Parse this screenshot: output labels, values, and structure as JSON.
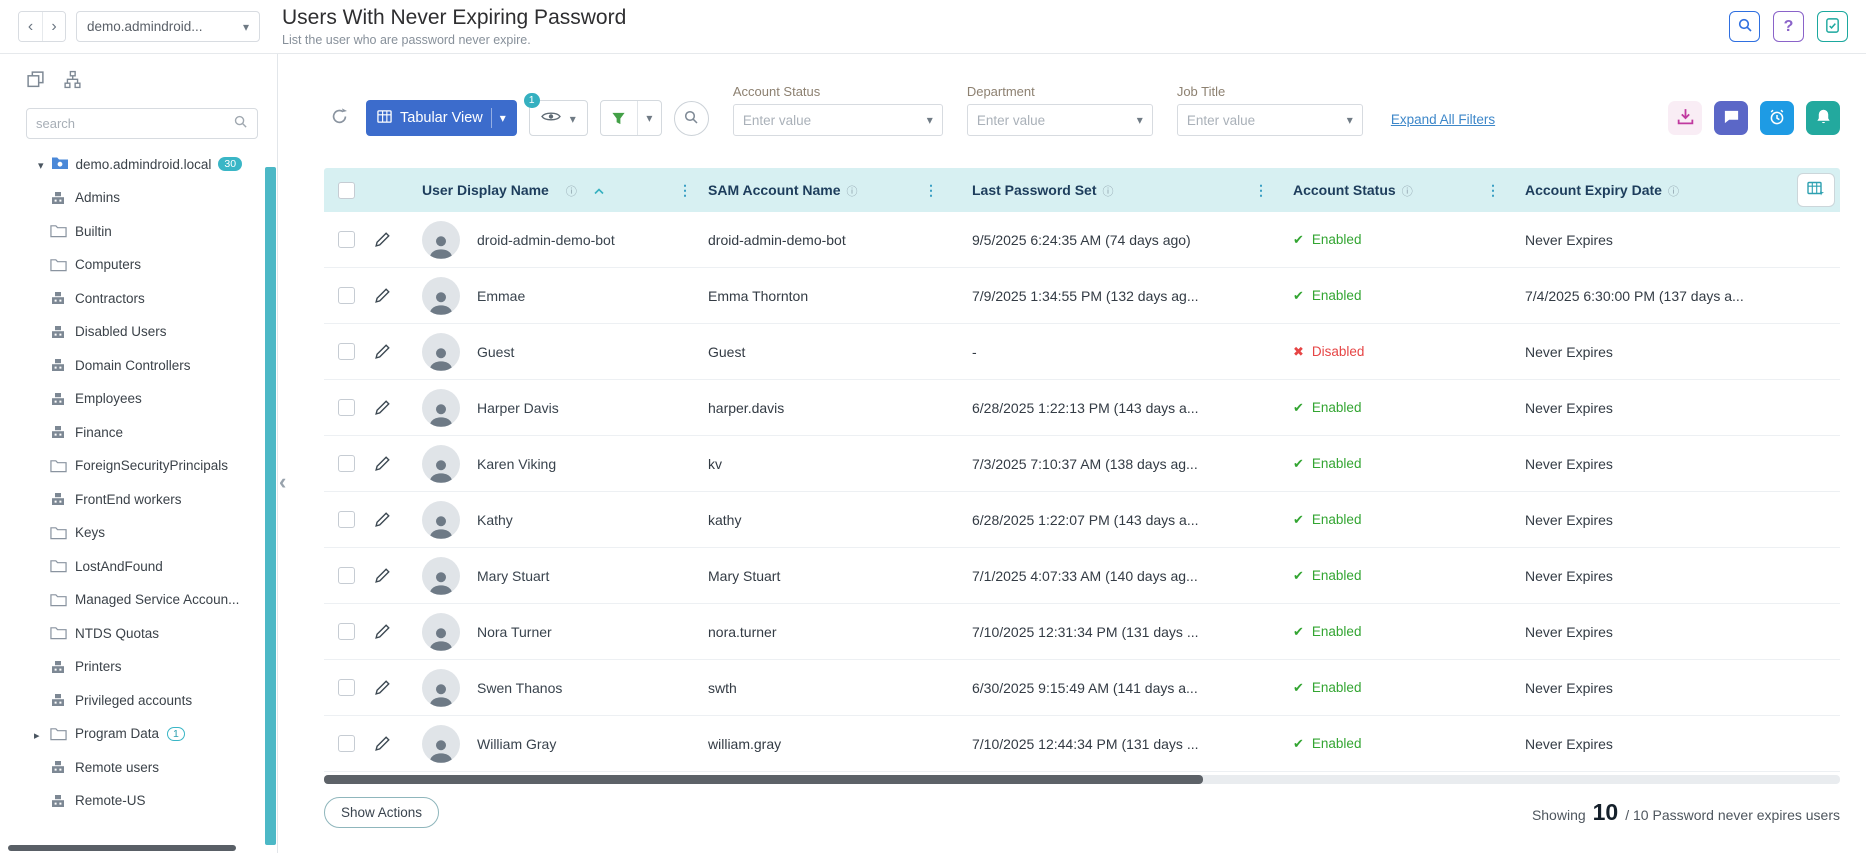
{
  "topbar": {
    "domain_selector": "demo.admindroid...",
    "title": "Users With Never Expiring Password",
    "subtitle": "List the user who are password never expire."
  },
  "sidebar": {
    "search_placeholder": "search",
    "tree_root": {
      "label": "demo.admindroid.local",
      "badge": "30"
    },
    "tree_items": [
      {
        "label": "Admins",
        "icon": "group"
      },
      {
        "label": "Builtin",
        "icon": "folder"
      },
      {
        "label": "Computers",
        "icon": "folder"
      },
      {
        "label": "Contractors",
        "icon": "group"
      },
      {
        "label": "Disabled Users",
        "icon": "group"
      },
      {
        "label": "Domain Controllers",
        "icon": "group"
      },
      {
        "label": "Employees",
        "icon": "group"
      },
      {
        "label": "Finance",
        "icon": "group"
      },
      {
        "label": "ForeignSecurityPrincipals",
        "icon": "folder"
      },
      {
        "label": "FrontEnd workers",
        "icon": "group"
      },
      {
        "label": "Keys",
        "icon": "folder"
      },
      {
        "label": "LostAndFound",
        "icon": "folder"
      },
      {
        "label": "Managed Service Accoun...",
        "icon": "folder"
      },
      {
        "label": "NTDS Quotas",
        "icon": "folder"
      },
      {
        "label": "Printers",
        "icon": "group"
      },
      {
        "label": "Privileged accounts",
        "icon": "group"
      },
      {
        "label": "Program Data",
        "icon": "folder",
        "badge": "1",
        "expandable": true
      },
      {
        "label": "Remote users",
        "icon": "group"
      },
      {
        "label": "Remote-US",
        "icon": "group"
      }
    ]
  },
  "toolbar": {
    "view_label": "Tabular View",
    "views_badge": "1",
    "filters": [
      {
        "label": "Account Status",
        "placeholder": "Enter value"
      },
      {
        "label": "Department",
        "placeholder": "Enter value"
      },
      {
        "label": "Job Title",
        "placeholder": "Enter value"
      }
    ],
    "expand_filters_label": "Expand All Filters"
  },
  "table": {
    "columns": [
      "User Display Name",
      "SAM Account Name",
      "Last Password Set",
      "Account Status",
      "Account Expiry Date"
    ],
    "rows": [
      {
        "display_name": "droid-admin-demo-bot",
        "sam": "droid-admin-demo-bot",
        "last_set": "9/5/2025 6:24:35 AM (74 days ago)",
        "status": "Enabled",
        "expiry": "Never Expires"
      },
      {
        "display_name": "Emmae",
        "sam": "Emma Thornton",
        "last_set": "7/9/2025 1:34:55 PM (132 days ag...",
        "status": "Enabled",
        "expiry": "7/4/2025 6:30:00 PM (137 days a..."
      },
      {
        "display_name": "Guest",
        "sam": "Guest",
        "last_set": "-",
        "status": "Disabled",
        "expiry": "Never Expires"
      },
      {
        "display_name": "Harper Davis",
        "sam": "harper.davis",
        "last_set": "6/28/2025 1:22:13 PM (143 days a...",
        "status": "Enabled",
        "expiry": "Never Expires"
      },
      {
        "display_name": "Karen Viking",
        "sam": "kv",
        "last_set": "7/3/2025 7:10:37 AM (138 days ag...",
        "status": "Enabled",
        "expiry": "Never Expires"
      },
      {
        "display_name": "Kathy",
        "sam": "kathy",
        "last_set": "6/28/2025 1:22:07 PM (143 days a...",
        "status": "Enabled",
        "expiry": "Never Expires"
      },
      {
        "display_name": "Mary Stuart",
        "sam": "Mary Stuart",
        "last_set": "7/1/2025 4:07:33 AM (140 days ag...",
        "status": "Enabled",
        "expiry": "Never Expires"
      },
      {
        "display_name": "Nora Turner",
        "sam": "nora.turner",
        "last_set": "7/10/2025 12:31:34 PM (131 days ...",
        "status": "Enabled",
        "expiry": "Never Expires"
      },
      {
        "display_name": "Swen Thanos",
        "sam": "swth",
        "last_set": "6/30/2025 9:15:49 AM (141 days a...",
        "status": "Enabled",
        "expiry": "Never Expires"
      },
      {
        "display_name": "William Gray",
        "sam": "william.gray",
        "last_set": "7/10/2025 12:44:34 PM (131 days ...",
        "status": "Enabled",
        "expiry": "Never Expires"
      }
    ]
  },
  "footer": {
    "show_actions_label": "Show Actions",
    "showing_prefix": "Showing",
    "showing_count": "10",
    "showing_suffix": "/ 10 Password never expires users"
  },
  "colors": {
    "accent_teal": "#35b0c0",
    "primary_blue": "#3c6ccc",
    "link_blue": "#3d87c9",
    "enabled_green": "#33a532",
    "disabled_red": "#e64545",
    "table_header_bg": "#d7f0f2",
    "filter_green": "#43a047",
    "download_magenta": "#c0399f",
    "message_indigo": "#5b67c7",
    "clock_blue": "#1e9be4",
    "bell_teal": "#23a99e"
  }
}
